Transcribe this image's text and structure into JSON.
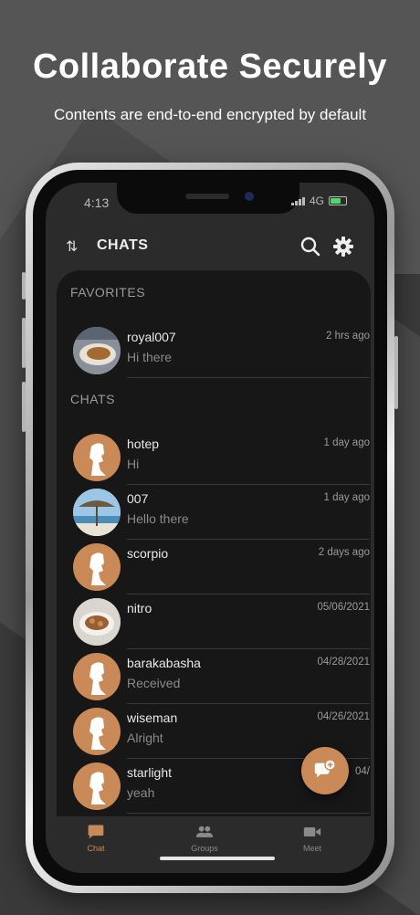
{
  "promo": {
    "headline": "Collaborate Securely",
    "subline": "Contents are end-to-end encrypted by default"
  },
  "status_bar": {
    "time": "4:13",
    "network": "4G"
  },
  "header": {
    "title": "CHATS"
  },
  "favorites": {
    "title": "FAVORITES",
    "items": [
      {
        "name": "royal007",
        "message": "Hi there",
        "time": "2 hrs ago",
        "avatar": "photo-plate"
      }
    ]
  },
  "chats": {
    "title": "CHATS",
    "items": [
      {
        "name": "hotep",
        "message": "Hi",
        "time": "1 day ago",
        "avatar": "default-profile"
      },
      {
        "name": "007",
        "message": "Hello there",
        "time": "1 day ago",
        "avatar": "photo-beach"
      },
      {
        "name": "scorpio",
        "message": "",
        "time": "2 days ago",
        "avatar": "default-profile"
      },
      {
        "name": "nitro",
        "message": "",
        "time": "05/06/2021",
        "avatar": "photo-food"
      },
      {
        "name": "barakabasha",
        "message": "Received",
        "time": "04/28/2021",
        "avatar": "default-profile"
      },
      {
        "name": "wiseman",
        "message": "Alright",
        "time": "04/26/2021",
        "avatar": "default-profile"
      },
      {
        "name": "starlight",
        "message": "yeah",
        "time": "04/",
        "avatar": "default-profile"
      }
    ]
  },
  "tabs": [
    {
      "label": "Chat",
      "icon": "chat-icon",
      "active": true
    },
    {
      "label": "Groups",
      "icon": "groups-icon",
      "active": false
    },
    {
      "label": "Meet",
      "icon": "video-icon",
      "active": false
    }
  ],
  "colors": {
    "accent": "#c98a57",
    "panel": "#171717",
    "screen": "#2b2b2b"
  }
}
